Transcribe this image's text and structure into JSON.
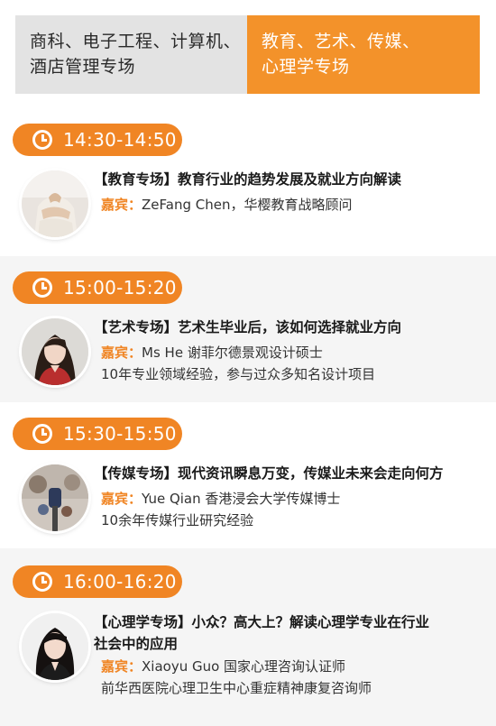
{
  "tabs": {
    "left_line1": "商科、电子工程、计算机、",
    "left_line2": "酒店管理专场",
    "right_line1": "教育、艺术、传媒、",
    "right_line2": "心理学专场"
  },
  "accent_color": "#f08524",
  "sessions": [
    {
      "time": "14:30-14:50",
      "topic": "【教育专场】教育行业的趋势发展及就业方向解读",
      "guest_label": "嘉宾：",
      "guest": "ZeFang Chen，华樱教育战略顾问",
      "detail": ""
    },
    {
      "time": "15:00-15:20",
      "topic": "【艺术专场】艺术生毕业后，该如何选择就业方向",
      "guest_label": "嘉宾：",
      "guest": "Ms He   谢菲尔德景观设计硕士",
      "detail": "10年专业领域经验，参与过众多知名设计项目"
    },
    {
      "time": "15:30-15:50",
      "topic": "【传媒专场】现代资讯瞬息万变，传媒业未来会走向何方",
      "guest_label": "嘉宾：",
      "guest": "Yue Qian   香港浸会大学传媒博士",
      "detail": "10余年传媒行业研究经验"
    },
    {
      "time": "16:00-16:20",
      "topic_line1": "【心理学专场】小众？高大上？解读心理学专业在行业",
      "topic_line2": "社会中的应用",
      "guest_label": "嘉宾：",
      "guest": "Xiaoyu Guo  国家心理咨询认证师",
      "detail": "前华西医院心理卫生中心重症精神康复咨询师"
    }
  ]
}
